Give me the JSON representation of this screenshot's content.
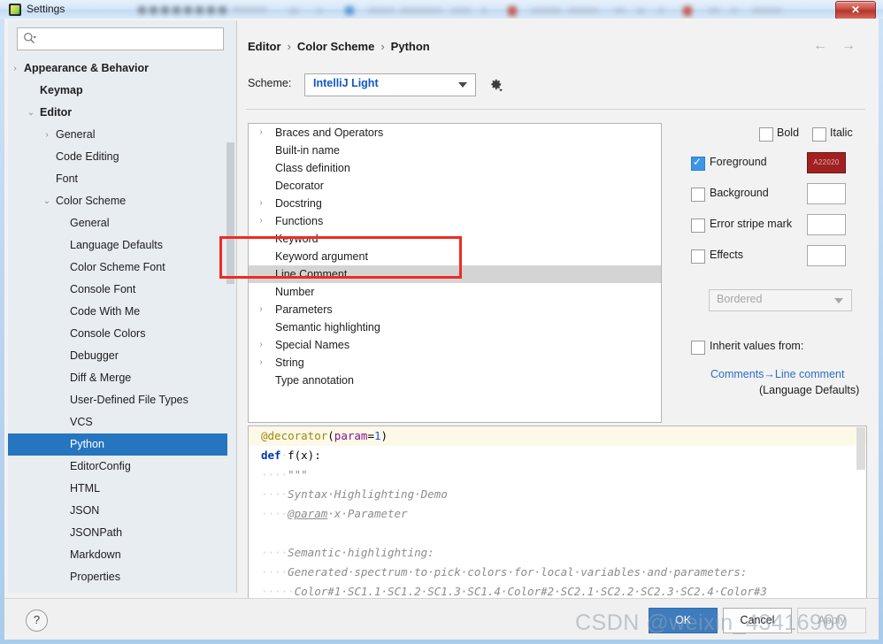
{
  "window": {
    "title": "Settings",
    "app_icon": "pycharm-icon",
    "close_label": "✕"
  },
  "search": {
    "placeholder": "",
    "value": "",
    "icon": "search-icon"
  },
  "sidebar": {
    "items": [
      {
        "label": "Appearance & Behavior",
        "indent": 18,
        "arrow": "›",
        "bold": true,
        "selected": false
      },
      {
        "label": "Keymap",
        "indent": 36,
        "arrow": "",
        "bold": true,
        "selected": false
      },
      {
        "label": "Editor",
        "indent": 36,
        "arrow": "⌄",
        "bold": true,
        "selected": false
      },
      {
        "label": "General",
        "indent": 54,
        "arrow": "›",
        "bold": false,
        "selected": false
      },
      {
        "label": "Code Editing",
        "indent": 54,
        "arrow": "",
        "bold": false,
        "selected": false
      },
      {
        "label": "Font",
        "indent": 54,
        "arrow": "",
        "bold": false,
        "selected": false
      },
      {
        "label": "Color Scheme",
        "indent": 54,
        "arrow": "⌄",
        "bold": false,
        "selected": false
      },
      {
        "label": "General",
        "indent": 70,
        "arrow": "",
        "bold": false,
        "selected": false
      },
      {
        "label": "Language Defaults",
        "indent": 70,
        "arrow": "",
        "bold": false,
        "selected": false
      },
      {
        "label": "Color Scheme Font",
        "indent": 70,
        "arrow": "",
        "bold": false,
        "selected": false
      },
      {
        "label": "Console Font",
        "indent": 70,
        "arrow": "",
        "bold": false,
        "selected": false
      },
      {
        "label": "Code With Me",
        "indent": 70,
        "arrow": "",
        "bold": false,
        "selected": false
      },
      {
        "label": "Console Colors",
        "indent": 70,
        "arrow": "",
        "bold": false,
        "selected": false
      },
      {
        "label": "Debugger",
        "indent": 70,
        "arrow": "",
        "bold": false,
        "selected": false
      },
      {
        "label": "Diff & Merge",
        "indent": 70,
        "arrow": "",
        "bold": false,
        "selected": false
      },
      {
        "label": "User-Defined File Types",
        "indent": 70,
        "arrow": "",
        "bold": false,
        "selected": false
      },
      {
        "label": "VCS",
        "indent": 70,
        "arrow": "",
        "bold": false,
        "selected": false
      },
      {
        "label": "Python",
        "indent": 70,
        "arrow": "",
        "bold": false,
        "selected": true
      },
      {
        "label": "EditorConfig",
        "indent": 70,
        "arrow": "",
        "bold": false,
        "selected": false
      },
      {
        "label": "HTML",
        "indent": 70,
        "arrow": "",
        "bold": false,
        "selected": false
      },
      {
        "label": "JSON",
        "indent": 70,
        "arrow": "",
        "bold": false,
        "selected": false
      },
      {
        "label": "JSONPath",
        "indent": 70,
        "arrow": "",
        "bold": false,
        "selected": false
      },
      {
        "label": "Markdown",
        "indent": 70,
        "arrow": "",
        "bold": false,
        "selected": false
      },
      {
        "label": "Properties",
        "indent": 70,
        "arrow": "",
        "bold": false,
        "selected": false
      }
    ]
  },
  "breadcrumb": {
    "parts": [
      "Editor",
      "Color Scheme",
      "Python"
    ],
    "separator": "›"
  },
  "nav": {
    "back_icon": "←",
    "forward_icon": "→"
  },
  "scheme": {
    "label": "Scheme:",
    "value": "IntelliJ Light",
    "gear_icon": "gear-icon"
  },
  "color_list": {
    "items": [
      {
        "label": "Braces and Operators",
        "arrow": "›",
        "highlighted": false
      },
      {
        "label": "Built-in name",
        "arrow": "",
        "highlighted": false
      },
      {
        "label": "Class definition",
        "arrow": "",
        "highlighted": false
      },
      {
        "label": "Decorator",
        "arrow": "",
        "highlighted": false
      },
      {
        "label": "Docstring",
        "arrow": "›",
        "highlighted": false
      },
      {
        "label": "Functions",
        "arrow": "›",
        "highlighted": false
      },
      {
        "label": "Keyword",
        "arrow": "",
        "highlighted": false
      },
      {
        "label": "Keyword argument",
        "arrow": "",
        "highlighted": false
      },
      {
        "label": "Line Comment",
        "arrow": "",
        "highlighted": true
      },
      {
        "label": "Number",
        "arrow": "",
        "highlighted": false
      },
      {
        "label": "Parameters",
        "arrow": "›",
        "highlighted": false
      },
      {
        "label": "Semantic highlighting",
        "arrow": "",
        "highlighted": false
      },
      {
        "label": "Special Names",
        "arrow": "›",
        "highlighted": false
      },
      {
        "label": "String",
        "arrow": "›",
        "highlighted": false
      },
      {
        "label": "Type annotation",
        "arrow": "",
        "highlighted": false
      }
    ]
  },
  "attributes": {
    "bold_label": "Bold",
    "bold_checked": false,
    "italic_label": "Italic",
    "italic_checked": false,
    "foreground_label": "Foreground",
    "foreground_checked": true,
    "foreground_color": "A22020",
    "background_label": "Background",
    "background_checked": false,
    "error_stripe_label": "Error stripe mark",
    "error_stripe_checked": false,
    "effects_label": "Effects",
    "effects_checked": false,
    "effects_value": "Bordered",
    "inherit_label": "Inherit values from:",
    "inherit_checked": false,
    "inherit_link": "Comments→Line comment",
    "inherit_sub": "(Language Defaults)"
  },
  "preview": {
    "lines": [
      {
        "highlighted": true,
        "tokens": [
          {
            "t": "@decorator",
            "c": "c-dec"
          },
          {
            "t": "(",
            "c": "c-pl"
          },
          {
            "t": "param",
            "c": "c-par"
          },
          {
            "t": "=",
            "c": "c-pl"
          },
          {
            "t": "1",
            "c": "c-num"
          },
          {
            "t": ")",
            "c": "c-pl"
          }
        ]
      },
      {
        "highlighted": false,
        "tokens": [
          {
            "t": "def",
            "c": "c-kw"
          },
          {
            "t": "·",
            "c": "c-dot"
          },
          {
            "t": "f(x):",
            "c": "c-pl"
          }
        ]
      },
      {
        "highlighted": false,
        "tokens": [
          {
            "t": "····",
            "c": "c-dot"
          },
          {
            "t": "\"\"\"",
            "c": "c-cmt"
          }
        ]
      },
      {
        "highlighted": false,
        "tokens": [
          {
            "t": "····",
            "c": "c-dot"
          },
          {
            "t": "Syntax·Highlighting·Demo",
            "c": "c-cmt"
          }
        ]
      },
      {
        "highlighted": false,
        "tokens": [
          {
            "t": "····",
            "c": "c-dot"
          },
          {
            "t": "@param",
            "c": "c-tag"
          },
          {
            "t": "·x·Parameter",
            "c": "c-cmt"
          }
        ]
      },
      {
        "highlighted": false,
        "tokens": []
      },
      {
        "highlighted": false,
        "tokens": [
          {
            "t": "····",
            "c": "c-dot"
          },
          {
            "t": "Semantic·highlighting:",
            "c": "c-cmt"
          }
        ]
      },
      {
        "highlighted": false,
        "tokens": [
          {
            "t": "····",
            "c": "c-dot"
          },
          {
            "t": "Generated·spectrum·to·pick·colors·for·local·variables·and·parameters:",
            "c": "c-cmt"
          }
        ]
      },
      {
        "highlighted": false,
        "tokens": [
          {
            "t": "·····",
            "c": "c-dot"
          },
          {
            "t": "Color#1·SC1.1·SC1.2·SC1.3·SC1.4·Color#2·SC2.1·SC2.2·SC2.3·SC2.4·Color#3",
            "c": "c-cmt"
          }
        ]
      }
    ]
  },
  "footer": {
    "help_label": "?",
    "ok_label": "OK",
    "cancel_label": "Cancel",
    "apply_label": "Apply"
  },
  "watermark": {
    "text": "CSDN @weixin_43416960"
  },
  "colors": {
    "selection_blue": "#2675bf",
    "accent_link": "#2a6fc4",
    "annotation_red": "#ef2b22",
    "foreground_swatch": "#a22020"
  }
}
